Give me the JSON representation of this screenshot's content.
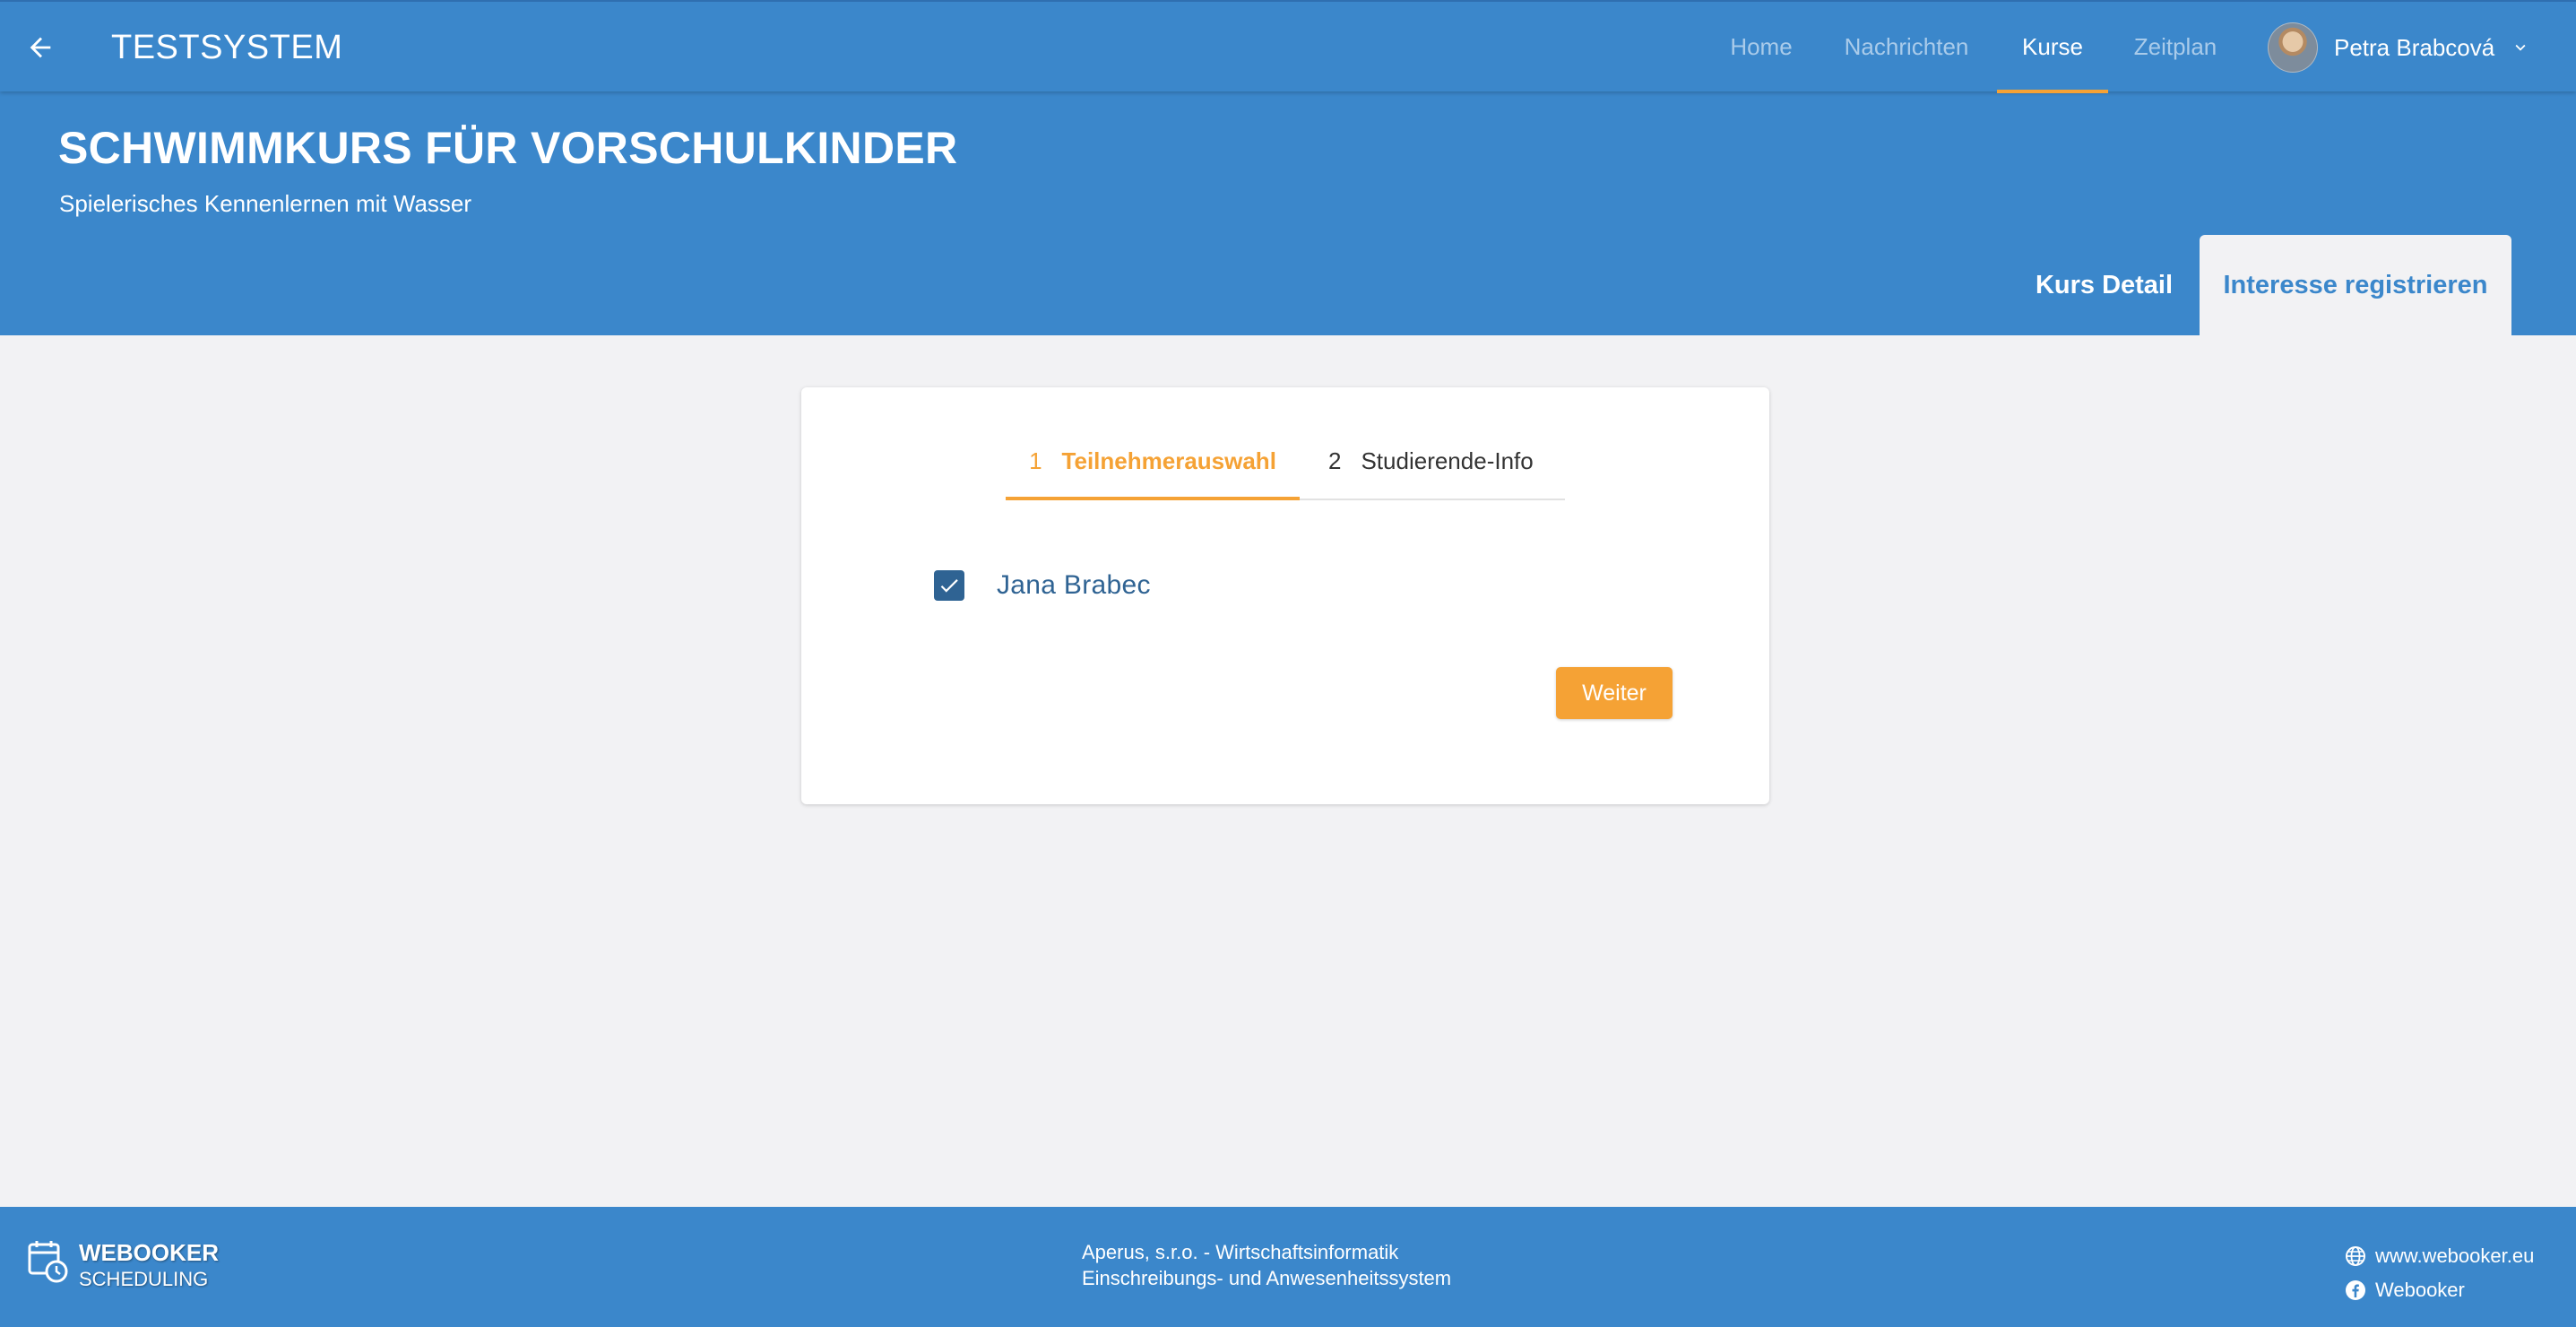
{
  "appbar": {
    "title": "TESTSYSTEM",
    "nav": [
      "Home",
      "Nachrichten",
      "Kurse",
      "Zeitplan"
    ],
    "active_nav": "Kurse",
    "user_name": "Petra Brabcová"
  },
  "header": {
    "course_title": "SCHWIMMKURS FÜR VORSCHULKINDER",
    "course_subtitle": "Spielerisches Kennenlernen mit Wasser",
    "tabs": [
      "Kurs Detail",
      "Interesse registrieren"
    ],
    "active_tab": "Interesse registrieren"
  },
  "stepper": {
    "steps": [
      {
        "num": "1",
        "label": "Teilnehmerauswahl"
      },
      {
        "num": "2",
        "label": "Studierende-Info"
      }
    ],
    "active_step": 1
  },
  "participants": [
    {
      "name": "Jana Brabec",
      "checked": true
    }
  ],
  "actions": {
    "next_label": "Weiter"
  },
  "footer": {
    "brand_name": "WEBOOKER",
    "brand_sub": "SCHEDULING",
    "company_line1": "Aperus, s.r.o. - Wirtschaftsinformatik",
    "company_line2": "Einschreibungs- und Anwesenheitssystem",
    "website": "www.webooker.eu",
    "facebook": "Webooker"
  },
  "colors": {
    "primary": "#3b87cb",
    "accent": "#f5a235",
    "dark_blue": "#2f6393",
    "background": "#f2f2f4"
  }
}
